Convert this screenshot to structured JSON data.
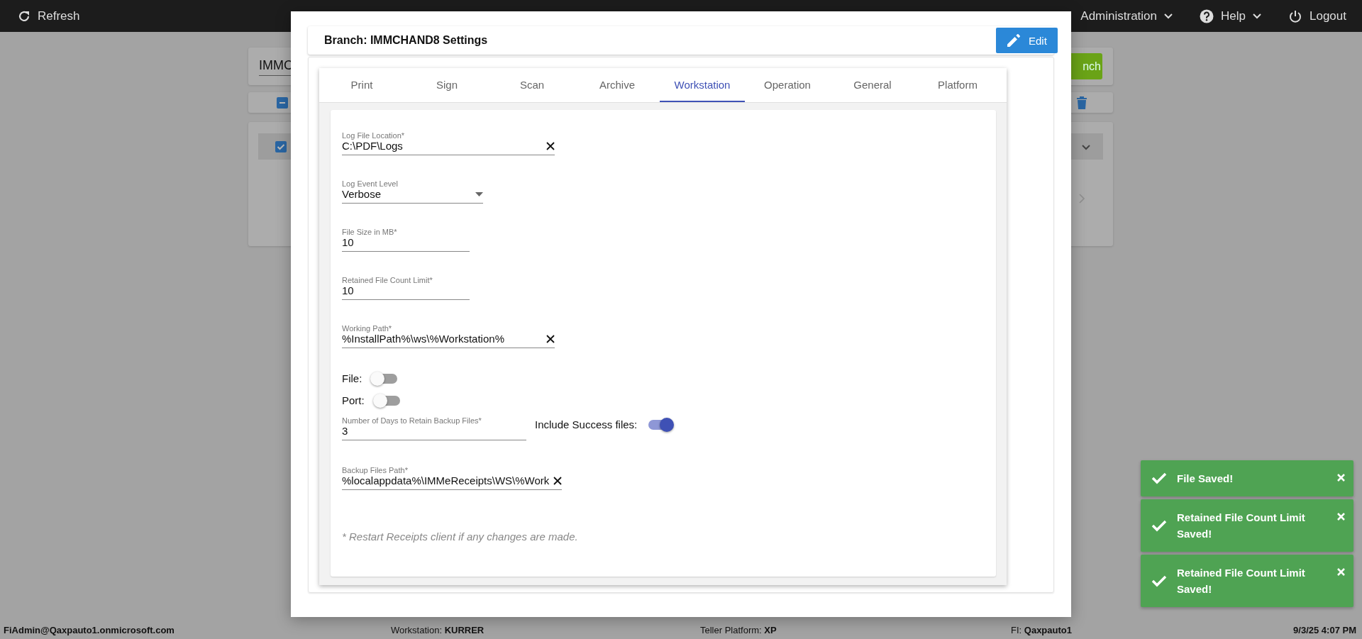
{
  "top_bar": {
    "refresh": "Refresh",
    "menus": [
      {
        "label": "Administration",
        "kind": "dropdown"
      },
      {
        "label": "Help",
        "kind": "help"
      },
      {
        "label": "Logout",
        "kind": "logout"
      }
    ]
  },
  "background": {
    "search_value": "IMMC",
    "add_button": "nch"
  },
  "dialog": {
    "title": "Branch: IMMCHAND8 Settings",
    "edit_button": "Edit",
    "tabs": [
      {
        "label": "Print",
        "selected": false
      },
      {
        "label": "Sign",
        "selected": false
      },
      {
        "label": "Scan",
        "selected": false
      },
      {
        "label": "Archive",
        "selected": false
      },
      {
        "label": "Workstation",
        "selected": true
      },
      {
        "label": "Operation",
        "selected": false
      },
      {
        "label": "General",
        "selected": false
      },
      {
        "label": "Platform",
        "selected": false
      }
    ],
    "fields": [
      {
        "kind": "text",
        "label": "Log File Location*",
        "value": "C:\\PDF\\Logs",
        "clearable": true
      },
      {
        "kind": "select",
        "label": "Log Event Level",
        "value": "Verbose"
      },
      {
        "kind": "text",
        "label": "File Size in MB*",
        "value": "10",
        "clearable": false
      },
      {
        "kind": "text",
        "label": "Retained File Count Limit*",
        "value": "10",
        "clearable": false
      },
      {
        "kind": "text",
        "label": "Working Path*",
        "value": "%InstallPath%\\ws\\%Workstation%",
        "clearable": true
      },
      {
        "kind": "toggle",
        "label": "File:",
        "on": false
      },
      {
        "kind": "toggle",
        "label": "Port:",
        "on": false
      },
      {
        "kind": "text",
        "label": "Number of Days to Retain Backup Files*",
        "value": "3",
        "clearable": false,
        "side_toggle": {
          "label": "Include Success files:",
          "on": true
        }
      },
      {
        "kind": "text",
        "label": "Backup Files Path*",
        "value": "%localappdata%\\IMMeReceipts\\WS\\%Work",
        "clearable": true
      }
    ],
    "note": "* Restart Receipts client if any changes are made."
  },
  "toasts": [
    {
      "message": "File Saved!"
    },
    {
      "message": "Retained File Count Limit Saved!"
    },
    {
      "message": "Retained File Count Limit Saved!"
    }
  ],
  "status_bar": {
    "user": "FiAdmin@Qaxpauto1.onmicrosoft.com",
    "workstation_label": "Workstation:",
    "workstation": "KURRER",
    "platform_label": "Teller Platform:",
    "platform": "XP",
    "fi_label": "FI:",
    "fi": "Qaxpauto1",
    "datetime": "9/3/25 4:07 PM"
  }
}
